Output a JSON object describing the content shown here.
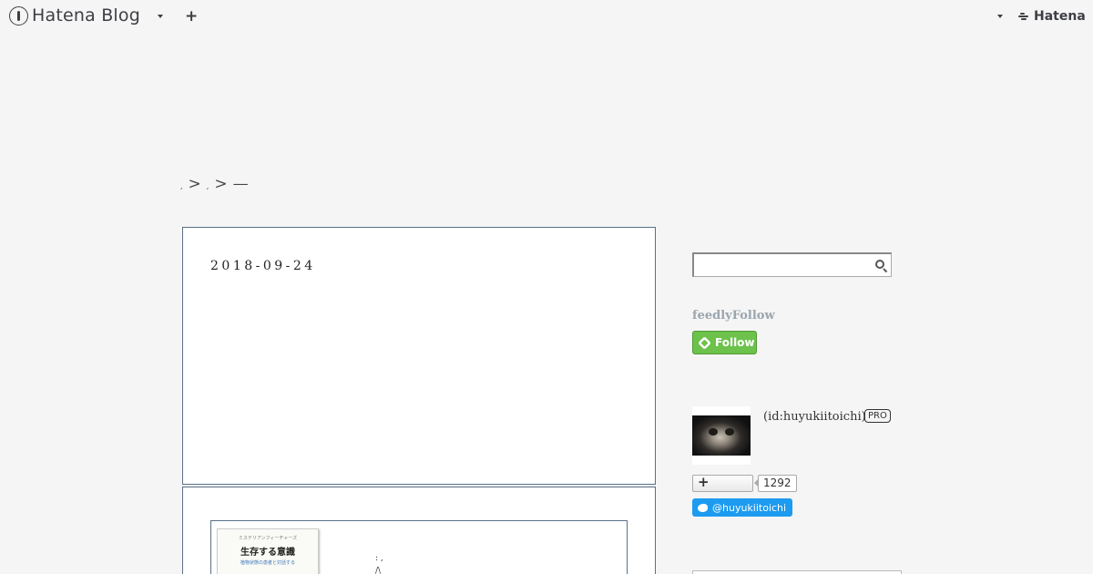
{
  "nav": {
    "logo_text": "Hatena Blog",
    "plus_label": "+",
    "brand_text": "Hatena"
  },
  "breadcrumb": {
    "items": [
      ",",
      ">",
      ",",
      ">",
      "—"
    ]
  },
  "article": {
    "date": "2018-09-24"
  },
  "embed": {
    "book_series": "ミステリアンフィーチャーズ",
    "book_title": "生存する意識",
    "book_subtitle": "植物状態の患者と対話する",
    "book_author": "",
    "text_line_1": ":   ,",
    "text_line_2": "/\\"
  },
  "sidebar": {
    "search_placeholder": "",
    "feedly_label": "feedlyFollow",
    "feedly_button": "Follow",
    "profile_id": "(id:huyukiitoichi)",
    "pro_badge": "PRO",
    "star_plus": "+",
    "star_count": "1292",
    "twitter_handle": "@huyukiitoichi"
  },
  "colors": {
    "background": "#f5f5f5",
    "box_border": "#5a7088",
    "feedly_green": "#6cc24a",
    "twitter_blue": "#1d9bf0"
  }
}
